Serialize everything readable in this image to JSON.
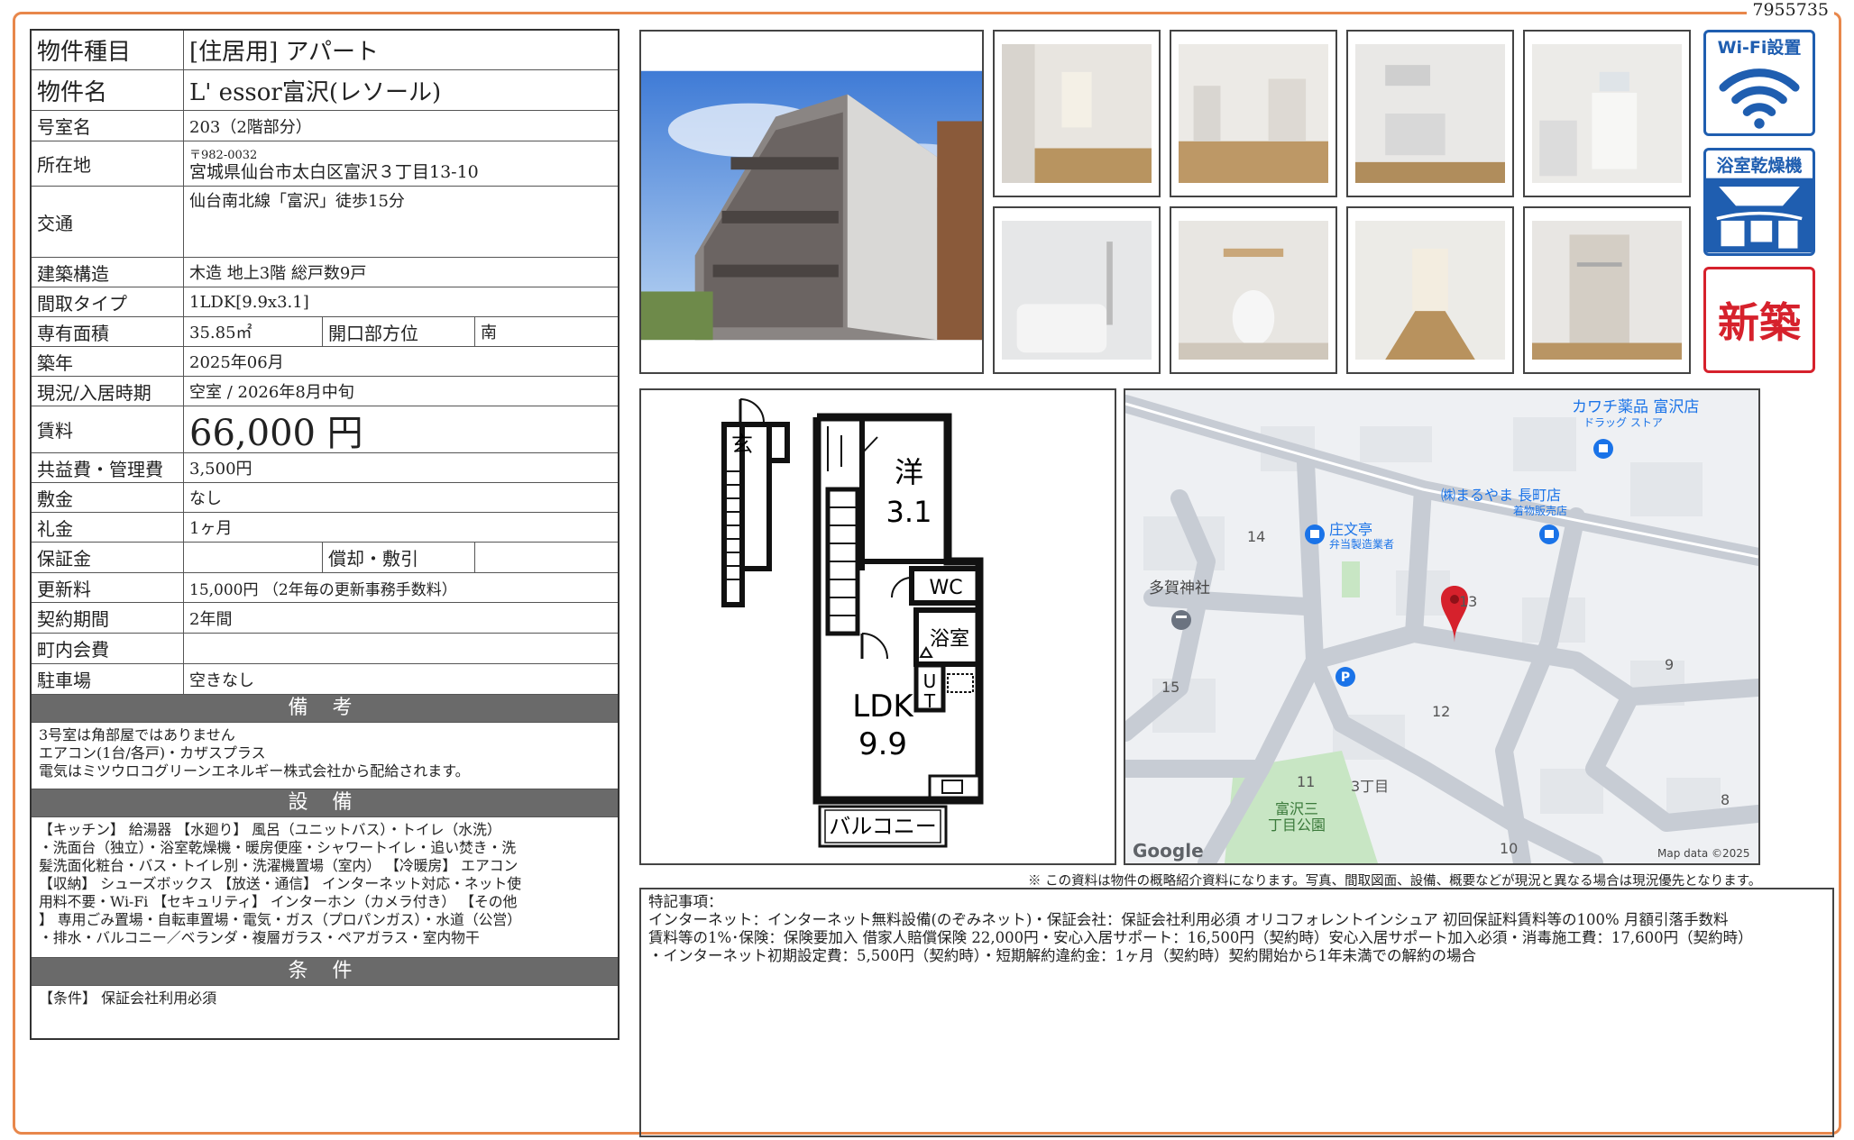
{
  "doc_id": "7955735",
  "property": {
    "type": {
      "label": "物件種目",
      "value": "[住居用]  アパート"
    },
    "name": {
      "label": "物件名",
      "value": "L' essor富沢(レソール)"
    },
    "room": {
      "label": "号室名",
      "value": "203（2階部分）"
    },
    "address": {
      "label": "所在地",
      "postal": "〒982-0032",
      "value": "宮城県仙台市太白区富沢３丁目13-10"
    },
    "access": {
      "label": "交通",
      "value": "仙台南北線「富沢」徒歩15分"
    },
    "structure": {
      "label": "建築構造",
      "value": "木造  地上3階  総戸数9戸"
    },
    "layout": {
      "label": "間取タイプ",
      "value": "1LDK[9.9x3.1]"
    },
    "area": {
      "label": "専有面積",
      "value": "35.85㎡",
      "sub_label": "開口部方位",
      "sub_value": "南"
    },
    "built": {
      "label": "築年",
      "value": "2025年06月"
    },
    "status": {
      "label": "現況/入居時期",
      "value": "空室  /  2026年8月中旬"
    },
    "rent": {
      "label": "賃料",
      "value": "66,000 円"
    },
    "fee": {
      "label": "共益費・管理費",
      "value": "3,500円"
    },
    "deposit": {
      "label": "敷金",
      "value": "なし"
    },
    "key_money": {
      "label": "礼金",
      "value": "1ヶ月"
    },
    "guarantee": {
      "label": "保証金",
      "value": "",
      "sub_label": "償却・敷引",
      "sub_value": ""
    },
    "renewal": {
      "label": "更新料",
      "value": "15,000円  （2年毎の更新事務手数料）"
    },
    "contract": {
      "label": "契約期間",
      "value": "2年間"
    },
    "town_fee": {
      "label": "町内会費",
      "value": ""
    },
    "parking": {
      "label": "駐車場",
      "value": "空きなし"
    }
  },
  "remarks": {
    "title": "備 考",
    "lines": [
      "3号室は角部屋ではありません",
      "エアコン(1台/各戸)・カザスプラス",
      "電気はミツウロコグリーンエネルギー株式会社から配給されます。"
    ]
  },
  "equipment": {
    "title": "設 備",
    "lines": [
      "【キッチン】 給湯器 【水廻り】 風呂（ユニットバス）・トイレ（水洗）",
      "・洗面台（独立）・浴室乾燥機・暖房便座・シャワートイレ・追い焚き・洗",
      "髪洗面化粧台・バス・トイレ別・洗濯機置場（室内） 【冷暖房】 エアコン",
      "【収納】 シューズボックス 【放送・通信】 インターネット対応・ネット使",
      "用料不要・Wi-Fi 【セキュリティ】 インターホン（カメラ付き） 【その他",
      "】 専用ごみ置場・自転車置場・電気・ガス（プロパンガス）・水道（公営）",
      "・排水・バルコニー／ベランダ・複層ガラス・ペアガラス・室内物干"
    ]
  },
  "conditions": {
    "title": "条 件",
    "text": "【条件】 保証会社利用必須"
  },
  "badges": {
    "wifi": "Wi-Fi設置",
    "dryer": "浴室乾燥機",
    "new": "新築"
  },
  "floorplan": {
    "entrance": "玄",
    "western": "洋",
    "western_size": "3.1",
    "wc": "WC",
    "bath": "浴室",
    "ut1": "U",
    "ut2": "T",
    "ldk": "LDK",
    "ldk_size": "9.9",
    "balcony": "バルコニー"
  },
  "map": {
    "labels": {
      "kawachi": "カワチ薬品 富沢店",
      "kawachi_sub": "ドラッグ ストア",
      "maruyama": "㈱まるやま 長町店",
      "maruyama_sub": "着物販売店",
      "shobuntei": "庄文亭",
      "shobuntei_sub": "弁当製造業者",
      "taga": "多賀神社",
      "park1": "富沢三",
      "park2": "丁目公園",
      "chome": "3丁目",
      "n14": "14",
      "n13": "13",
      "n15": "15",
      "n12": "12",
      "n9": "9",
      "n11": "11",
      "n8": "8",
      "n10": "10",
      "google": "Google",
      "mapdata": "Map data ©2025"
    }
  },
  "disclaimer": "※ この資料は物件の概略紹介資料になります。写真、間取図面、設備、概要などが現況と異なる場合は現況優先となります。",
  "special": {
    "title": "特記事項：",
    "lines": [
      "インターネット：インターネット無料設備(のぞみネット)・保証会社：保証会社利用必須 オリコフォレントインシュア 初回保証料賃料等の100% 月額引落手数料",
      "賃料等の1%･保険：保険要加入 借家人賠償保険 22,000円・安心入居サポート：16,500円（契約時）安心入居サポート加入必須・消毒施工費：17,600円（契約時）",
      "・インターネット初期設定費：5,500円（契約時）・短期解約違約金：1ヶ月（契約時）契約開始から1年未満での解約の場合"
    ]
  },
  "colors": {
    "frame": "#e8874b",
    "banner": "#6a6a6a",
    "wifi": "#1f5eb0",
    "new_badge": "#d6212c",
    "pin": "#d6212c"
  }
}
